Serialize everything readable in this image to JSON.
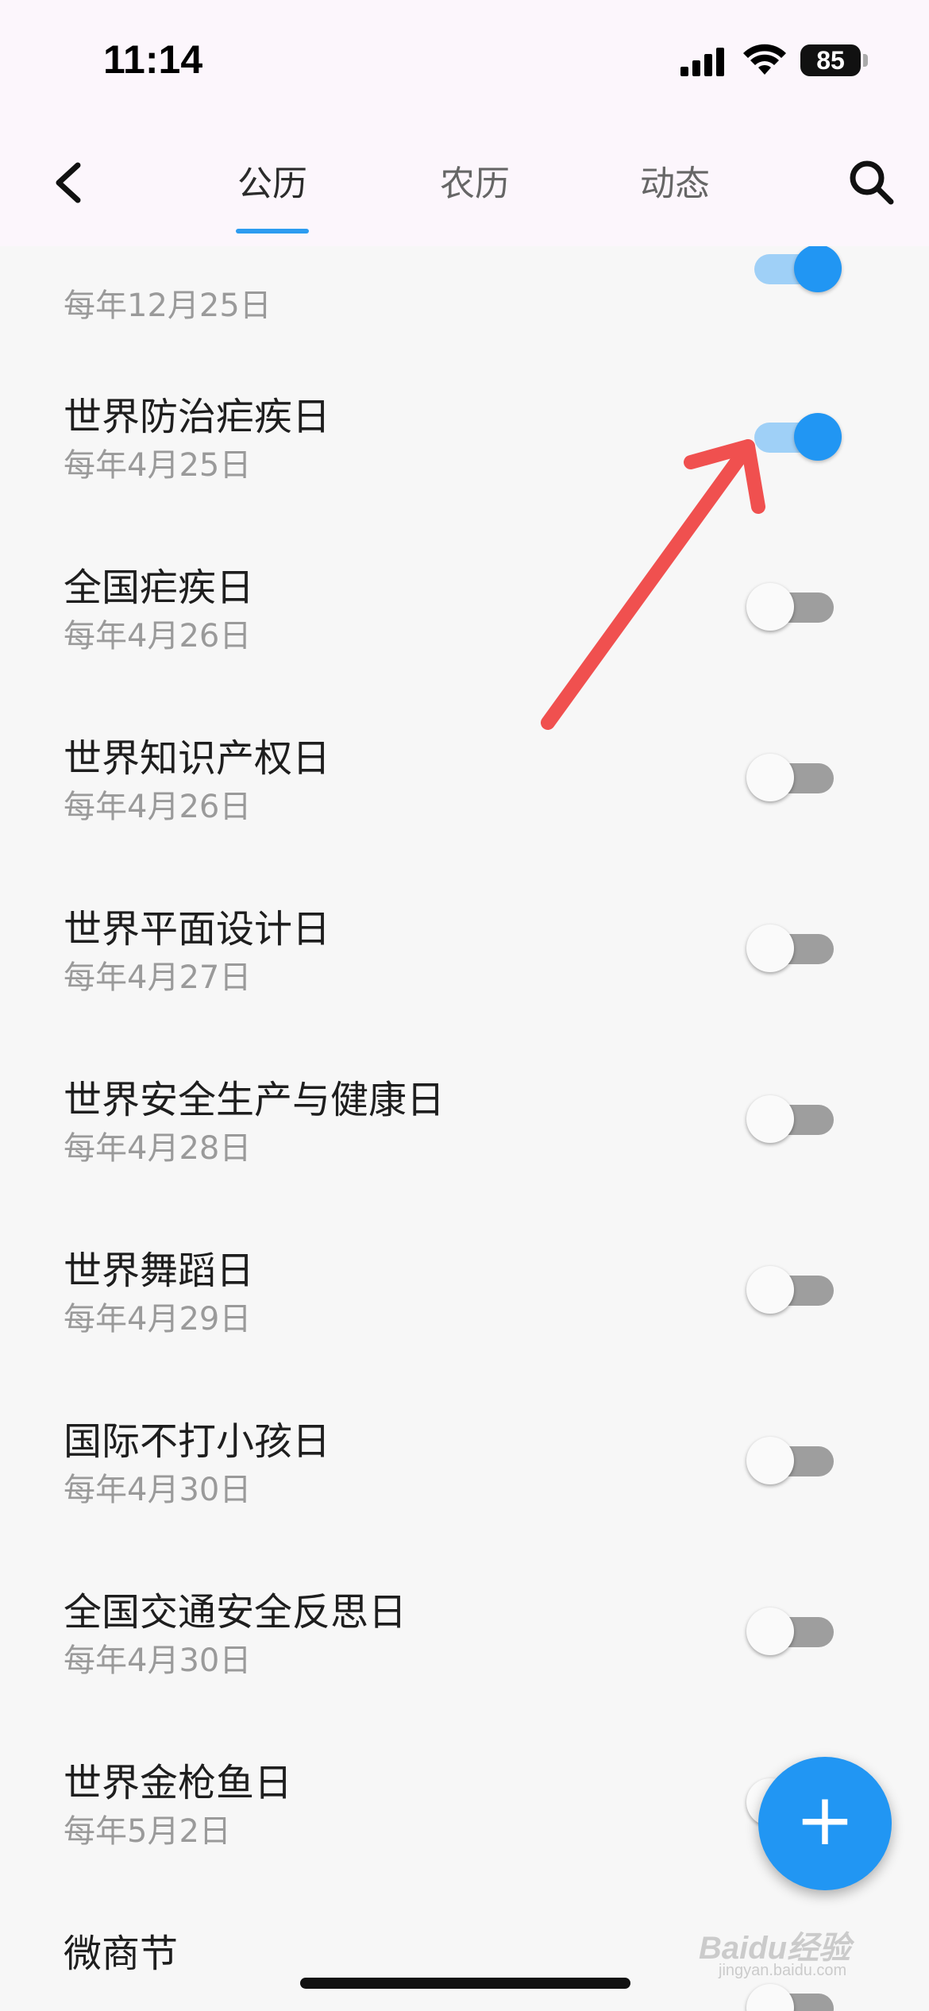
{
  "status_bar": {
    "time": "11:14",
    "battery": "85"
  },
  "header": {
    "tabs": [
      {
        "label": "公历",
        "active": true
      },
      {
        "label": "农历",
        "active": false
      },
      {
        "label": "动态",
        "active": false
      }
    ],
    "back_icon": "chevron-left-icon",
    "search_icon": "search-icon"
  },
  "list": {
    "items": [
      {
        "title": "",
        "subtitle": "每年12月25日",
        "enabled": true
      },
      {
        "title": "世界防治疟疾日",
        "subtitle": "每年4月25日",
        "enabled": true
      },
      {
        "title": "全国疟疾日",
        "subtitle": "每年4月26日",
        "enabled": false
      },
      {
        "title": "世界知识产权日",
        "subtitle": "每年4月26日",
        "enabled": false
      },
      {
        "title": "世界平面设计日",
        "subtitle": "每年4月27日",
        "enabled": false
      },
      {
        "title": "世界安全生产与健康日",
        "subtitle": "每年4月28日",
        "enabled": false
      },
      {
        "title": "世界舞蹈日",
        "subtitle": "每年4月29日",
        "enabled": false
      },
      {
        "title": "国际不打小孩日",
        "subtitle": "每年4月30日",
        "enabled": false
      },
      {
        "title": "全国交通安全反思日",
        "subtitle": "每年4月30日",
        "enabled": false
      },
      {
        "title": "世界金枪鱼日",
        "subtitle": "每年5月2日",
        "enabled": false
      },
      {
        "title": "微商节",
        "subtitle": "",
        "enabled": false
      }
    ]
  },
  "fab": {
    "label": "+"
  },
  "watermark": {
    "brand": "Baidu经验",
    "url": "jingyan.baidu.com"
  },
  "colors": {
    "accent": "#2196f3",
    "tab_underline": "#2d9cf0",
    "annotation_arrow": "#f0504f"
  }
}
